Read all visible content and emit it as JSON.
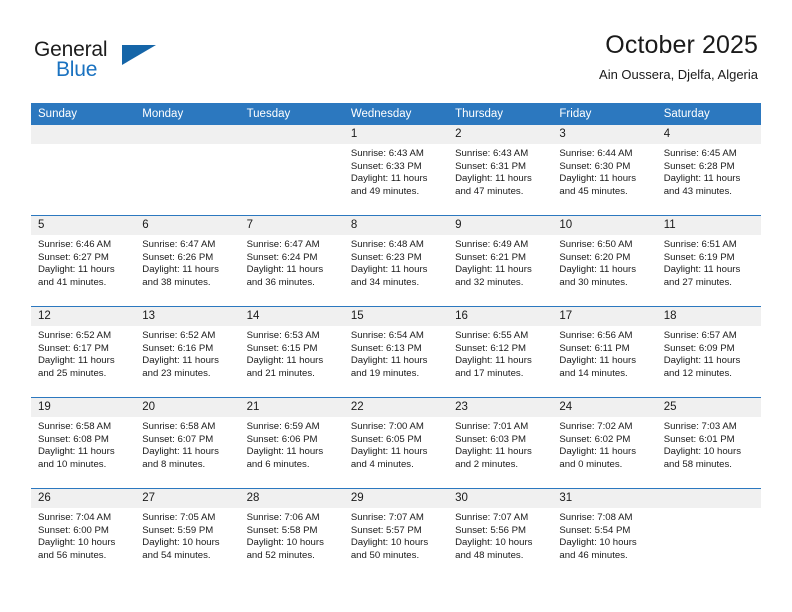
{
  "brand": {
    "name_part1": "General",
    "name_part2": "Blue",
    "accent_color": "#1a72c0",
    "triangle_color": "#1565a8"
  },
  "header": {
    "month_title": "October 2025",
    "location": "Ain Oussera, Djelfa, Algeria"
  },
  "calendar": {
    "header_background": "#2c78bf",
    "date_row_background": "#f0f0f0",
    "weekdays": [
      "Sunday",
      "Monday",
      "Tuesday",
      "Wednesday",
      "Thursday",
      "Friday",
      "Saturday"
    ],
    "weeks": [
      [
        {
          "date": "",
          "sunrise": "",
          "sunset": "",
          "daylight1": "",
          "daylight2": ""
        },
        {
          "date": "",
          "sunrise": "",
          "sunset": "",
          "daylight1": "",
          "daylight2": ""
        },
        {
          "date": "",
          "sunrise": "",
          "sunset": "",
          "daylight1": "",
          "daylight2": ""
        },
        {
          "date": "1",
          "sunrise": "Sunrise: 6:43 AM",
          "sunset": "Sunset: 6:33 PM",
          "daylight1": "Daylight: 11 hours",
          "daylight2": "and 49 minutes."
        },
        {
          "date": "2",
          "sunrise": "Sunrise: 6:43 AM",
          "sunset": "Sunset: 6:31 PM",
          "daylight1": "Daylight: 11 hours",
          "daylight2": "and 47 minutes."
        },
        {
          "date": "3",
          "sunrise": "Sunrise: 6:44 AM",
          "sunset": "Sunset: 6:30 PM",
          "daylight1": "Daylight: 11 hours",
          "daylight2": "and 45 minutes."
        },
        {
          "date": "4",
          "sunrise": "Sunrise: 6:45 AM",
          "sunset": "Sunset: 6:28 PM",
          "daylight1": "Daylight: 11 hours",
          "daylight2": "and 43 minutes."
        }
      ],
      [
        {
          "date": "5",
          "sunrise": "Sunrise: 6:46 AM",
          "sunset": "Sunset: 6:27 PM",
          "daylight1": "Daylight: 11 hours",
          "daylight2": "and 41 minutes."
        },
        {
          "date": "6",
          "sunrise": "Sunrise: 6:47 AM",
          "sunset": "Sunset: 6:26 PM",
          "daylight1": "Daylight: 11 hours",
          "daylight2": "and 38 minutes."
        },
        {
          "date": "7",
          "sunrise": "Sunrise: 6:47 AM",
          "sunset": "Sunset: 6:24 PM",
          "daylight1": "Daylight: 11 hours",
          "daylight2": "and 36 minutes."
        },
        {
          "date": "8",
          "sunrise": "Sunrise: 6:48 AM",
          "sunset": "Sunset: 6:23 PM",
          "daylight1": "Daylight: 11 hours",
          "daylight2": "and 34 minutes."
        },
        {
          "date": "9",
          "sunrise": "Sunrise: 6:49 AM",
          "sunset": "Sunset: 6:21 PM",
          "daylight1": "Daylight: 11 hours",
          "daylight2": "and 32 minutes."
        },
        {
          "date": "10",
          "sunrise": "Sunrise: 6:50 AM",
          "sunset": "Sunset: 6:20 PM",
          "daylight1": "Daylight: 11 hours",
          "daylight2": "and 30 minutes."
        },
        {
          "date": "11",
          "sunrise": "Sunrise: 6:51 AM",
          "sunset": "Sunset: 6:19 PM",
          "daylight1": "Daylight: 11 hours",
          "daylight2": "and 27 minutes."
        }
      ],
      [
        {
          "date": "12",
          "sunrise": "Sunrise: 6:52 AM",
          "sunset": "Sunset: 6:17 PM",
          "daylight1": "Daylight: 11 hours",
          "daylight2": "and 25 minutes."
        },
        {
          "date": "13",
          "sunrise": "Sunrise: 6:52 AM",
          "sunset": "Sunset: 6:16 PM",
          "daylight1": "Daylight: 11 hours",
          "daylight2": "and 23 minutes."
        },
        {
          "date": "14",
          "sunrise": "Sunrise: 6:53 AM",
          "sunset": "Sunset: 6:15 PM",
          "daylight1": "Daylight: 11 hours",
          "daylight2": "and 21 minutes."
        },
        {
          "date": "15",
          "sunrise": "Sunrise: 6:54 AM",
          "sunset": "Sunset: 6:13 PM",
          "daylight1": "Daylight: 11 hours",
          "daylight2": "and 19 minutes."
        },
        {
          "date": "16",
          "sunrise": "Sunrise: 6:55 AM",
          "sunset": "Sunset: 6:12 PM",
          "daylight1": "Daylight: 11 hours",
          "daylight2": "and 17 minutes."
        },
        {
          "date": "17",
          "sunrise": "Sunrise: 6:56 AM",
          "sunset": "Sunset: 6:11 PM",
          "daylight1": "Daylight: 11 hours",
          "daylight2": "and 14 minutes."
        },
        {
          "date": "18",
          "sunrise": "Sunrise: 6:57 AM",
          "sunset": "Sunset: 6:09 PM",
          "daylight1": "Daylight: 11 hours",
          "daylight2": "and 12 minutes."
        }
      ],
      [
        {
          "date": "19",
          "sunrise": "Sunrise: 6:58 AM",
          "sunset": "Sunset: 6:08 PM",
          "daylight1": "Daylight: 11 hours",
          "daylight2": "and 10 minutes."
        },
        {
          "date": "20",
          "sunrise": "Sunrise: 6:58 AM",
          "sunset": "Sunset: 6:07 PM",
          "daylight1": "Daylight: 11 hours",
          "daylight2": "and 8 minutes."
        },
        {
          "date": "21",
          "sunrise": "Sunrise: 6:59 AM",
          "sunset": "Sunset: 6:06 PM",
          "daylight1": "Daylight: 11 hours",
          "daylight2": "and 6 minutes."
        },
        {
          "date": "22",
          "sunrise": "Sunrise: 7:00 AM",
          "sunset": "Sunset: 6:05 PM",
          "daylight1": "Daylight: 11 hours",
          "daylight2": "and 4 minutes."
        },
        {
          "date": "23",
          "sunrise": "Sunrise: 7:01 AM",
          "sunset": "Sunset: 6:03 PM",
          "daylight1": "Daylight: 11 hours",
          "daylight2": "and 2 minutes."
        },
        {
          "date": "24",
          "sunrise": "Sunrise: 7:02 AM",
          "sunset": "Sunset: 6:02 PM",
          "daylight1": "Daylight: 11 hours",
          "daylight2": "and 0 minutes."
        },
        {
          "date": "25",
          "sunrise": "Sunrise: 7:03 AM",
          "sunset": "Sunset: 6:01 PM",
          "daylight1": "Daylight: 10 hours",
          "daylight2": "and 58 minutes."
        }
      ],
      [
        {
          "date": "26",
          "sunrise": "Sunrise: 7:04 AM",
          "sunset": "Sunset: 6:00 PM",
          "daylight1": "Daylight: 10 hours",
          "daylight2": "and 56 minutes."
        },
        {
          "date": "27",
          "sunrise": "Sunrise: 7:05 AM",
          "sunset": "Sunset: 5:59 PM",
          "daylight1": "Daylight: 10 hours",
          "daylight2": "and 54 minutes."
        },
        {
          "date": "28",
          "sunrise": "Sunrise: 7:06 AM",
          "sunset": "Sunset: 5:58 PM",
          "daylight1": "Daylight: 10 hours",
          "daylight2": "and 52 minutes."
        },
        {
          "date": "29",
          "sunrise": "Sunrise: 7:07 AM",
          "sunset": "Sunset: 5:57 PM",
          "daylight1": "Daylight: 10 hours",
          "daylight2": "and 50 minutes."
        },
        {
          "date": "30",
          "sunrise": "Sunrise: 7:07 AM",
          "sunset": "Sunset: 5:56 PM",
          "daylight1": "Daylight: 10 hours",
          "daylight2": "and 48 minutes."
        },
        {
          "date": "31",
          "sunrise": "Sunrise: 7:08 AM",
          "sunset": "Sunset: 5:54 PM",
          "daylight1": "Daylight: 10 hours",
          "daylight2": "and 46 minutes."
        },
        {
          "date": "",
          "sunrise": "",
          "sunset": "",
          "daylight1": "",
          "daylight2": ""
        }
      ]
    ]
  }
}
